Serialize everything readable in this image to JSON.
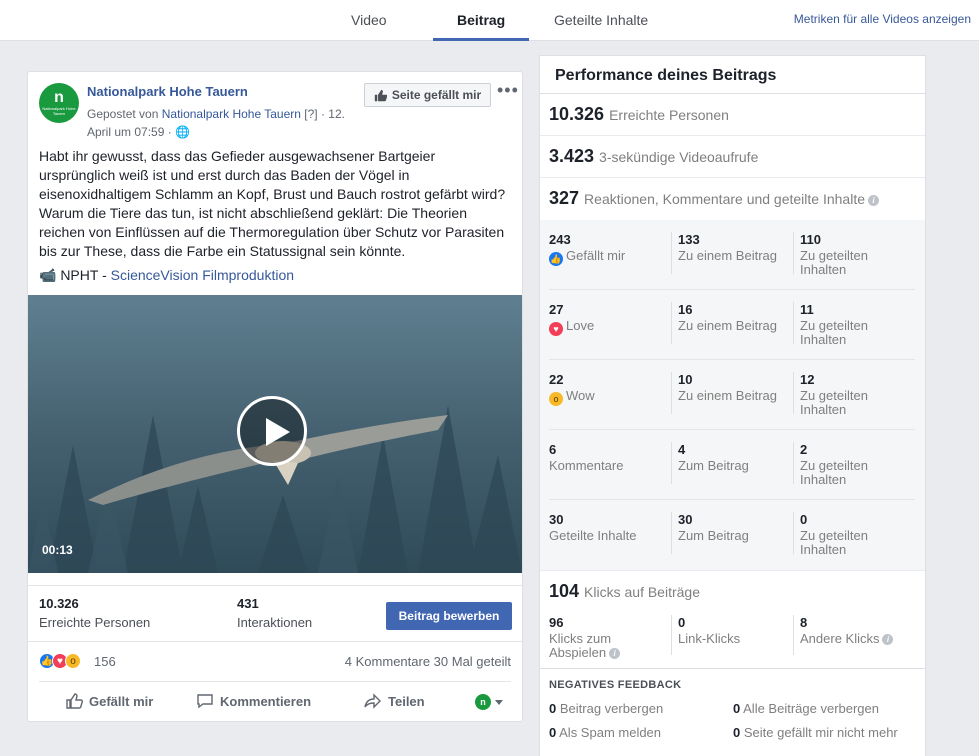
{
  "tabs": [
    {
      "label": "Video"
    },
    {
      "label": "Beitrag"
    },
    {
      "label": "Geteilte Inhalte"
    }
  ],
  "top_link": "Metriken für alle Videos anzeigen",
  "post": {
    "avatar_text": "n",
    "avatar_subtext": "Nationalpark Hohe Tauern",
    "page_name": "Nationalpark Hohe Tauern",
    "posted_by_prefix": "Gepostet von",
    "posted_by": "Nationalpark Hohe Tauern",
    "posted_by_suffix": "[?] · 12. April um 07:59 ·",
    "like_page_button": "Seite gefällt mir",
    "text": "Habt ihr gewusst, dass das Gefieder ausgewachsener Bartgeier ursprünglich weiß ist und erst durch das Baden der Vögel in eisenoxidhaltigem Schlamm an Kopf, Brust und Bauch rostrot gefärbt wird? Warum die Tiere das tun, ist nicht abschließend geklärt: Die Theorien reichen von Einflüssen auf die Thermoregulation über Schutz vor Parasiten bis zur These, dass die Farbe ein Statussignal sein könnte.",
    "credit_prefix": "📹 NPHT -",
    "credit_link": "ScienceVision Filmproduktion",
    "video_duration": "00:13",
    "reach_value": "10.326",
    "reach_label": "Erreichte Personen",
    "interactions_value": "431",
    "interactions_label": "Interaktionen",
    "promote_button": "Beitrag bewerben",
    "reactions_count": "156",
    "comments_shares": "4 Kommentare  30 Mal geteilt",
    "actions": {
      "like": "Gefällt mir",
      "comment": "Kommentieren",
      "share": "Teilen"
    },
    "audience_icon_text": "n"
  },
  "performance": {
    "title": "Performance deines Beitrags",
    "reached": {
      "value": "10.326",
      "label": "Erreichte Personen"
    },
    "views": {
      "value": "3.423",
      "label": "3-sekündige Videoaufrufe"
    },
    "engagement": {
      "value": "327",
      "label": "Reaktionen, Kommentare und geteilte Inhalte"
    },
    "breakdown": [
      {
        "total": "243",
        "label": "Gefällt mir",
        "icon": "like",
        "post": "133",
        "post_label": "Zu einem Beitrag",
        "shared": "110",
        "shared_label": "Zu geteilten Inhalten"
      },
      {
        "total": "27",
        "label": "Love",
        "icon": "love",
        "post": "16",
        "post_label": "Zu einem Beitrag",
        "shared": "11",
        "shared_label": "Zu geteilten Inhalten"
      },
      {
        "total": "22",
        "label": "Wow",
        "icon": "wow",
        "post": "10",
        "post_label": "Zu einem Beitrag",
        "shared": "12",
        "shared_label": "Zu geteilten Inhalten"
      },
      {
        "total": "6",
        "label": "Kommentare",
        "icon": "",
        "post": "4",
        "post_label": "Zum Beitrag",
        "shared": "2",
        "shared_label": "Zu geteilten Inhalten"
      },
      {
        "total": "30",
        "label": "Geteilte Inhalte",
        "icon": "",
        "post": "30",
        "post_label": "Zum Beitrag",
        "shared": "0",
        "shared_label": "Zu geteilten Inhalten"
      }
    ],
    "clicks": {
      "value": "104",
      "label": "Klicks auf Beiträge",
      "play": {
        "value": "96",
        "label": "Klicks zum Abspielen"
      },
      "link": {
        "value": "0",
        "label": "Link-Klicks"
      },
      "other": {
        "value": "8",
        "label": "Andere Klicks"
      }
    },
    "negative": {
      "title": "NEGATIVES FEEDBACK",
      "hide_post": {
        "value": "0",
        "label": "Beitrag verbergen"
      },
      "hide_all": {
        "value": "0",
        "label": "Alle Beiträge verbergen"
      },
      "spam": {
        "value": "0",
        "label": "Als Spam melden"
      },
      "unlike": {
        "value": "0",
        "label": "Seite gefällt mir nicht mehr"
      }
    }
  },
  "colors": {
    "accent": "#4267b2",
    "link": "#365899",
    "brand_green": "#1a9a3f"
  }
}
